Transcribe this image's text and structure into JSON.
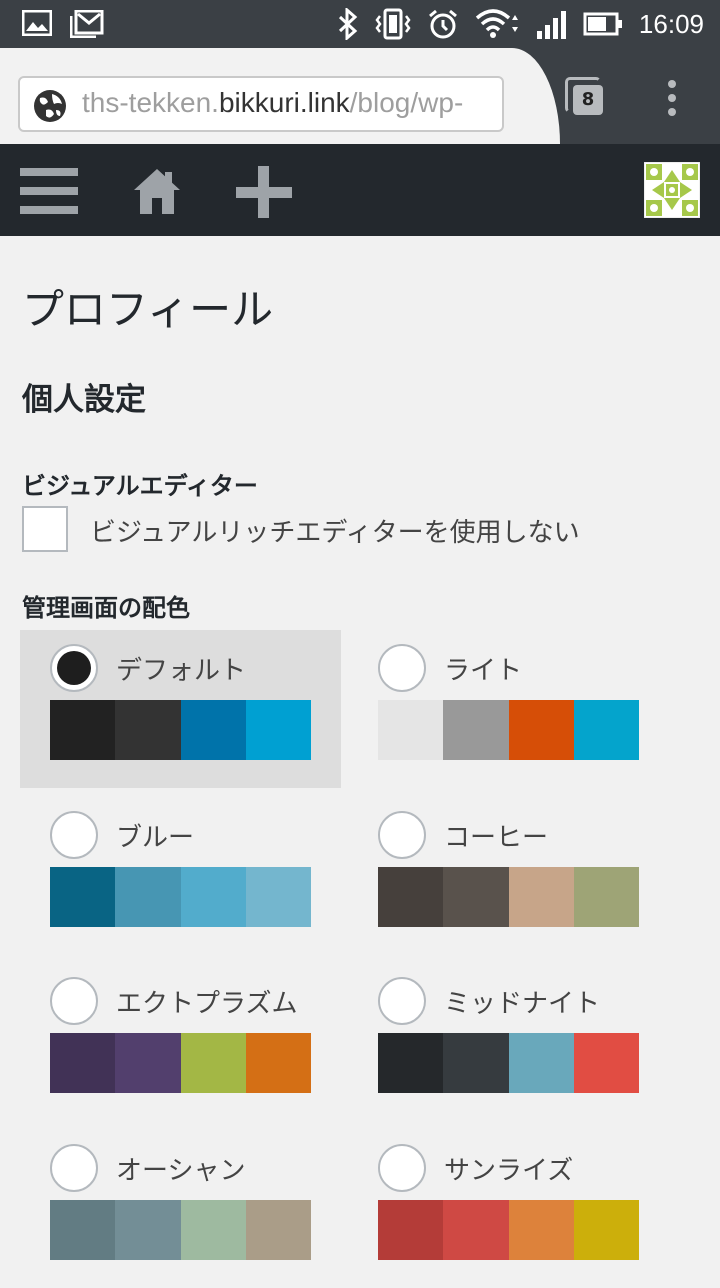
{
  "statusbar": {
    "time": "16:09",
    "icons": [
      "image-icon",
      "gmail-icon",
      "bluetooth-icon",
      "vibrate-icon",
      "alarm-icon",
      "wifi-icon",
      "signal-icon",
      "battery-icon"
    ]
  },
  "browser": {
    "url_prefix": "ths-tekken.",
    "url_host": "bikkuri.link",
    "url_suffix": "/blog/wp-",
    "tab_count": "8"
  },
  "adminbar": {
    "icons": [
      "hamburger-menu-icon",
      "home-icon",
      "plus-icon"
    ],
    "avatar_color": "#a6c84a"
  },
  "page": {
    "title": "プロフィール",
    "section_title": "個人設定",
    "visual_editor_label": "ビジュアルエディター",
    "visual_editor_checkbox_label": "ビジュアルリッチエディターを使用しない",
    "visual_editor_checked": false,
    "color_scheme_label": "管理画面の配色"
  },
  "color_schemes": [
    {
      "name": "デフォルト",
      "selected": true,
      "colors": [
        "#222222",
        "#333333",
        "#0073aa",
        "#00a0d2"
      ]
    },
    {
      "name": "ライト",
      "selected": false,
      "colors": [
        "#e5e5e5",
        "#999999",
        "#d64e07",
        "#04a4cc"
      ]
    },
    {
      "name": "ブルー",
      "selected": false,
      "colors": [
        "#096484",
        "#4796b3",
        "#52accc",
        "#74b6ce"
      ]
    },
    {
      "name": "コーヒー",
      "selected": false,
      "colors": [
        "#46403c",
        "#59524c",
        "#c7a589",
        "#9ea476"
      ]
    },
    {
      "name": "エクトプラズム",
      "selected": false,
      "colors": [
        "#413256",
        "#523f6d",
        "#a3b745",
        "#d46f15"
      ]
    },
    {
      "name": "ミッドナイト",
      "selected": false,
      "colors": [
        "#25282b",
        "#363b3f",
        "#69a8bb",
        "#e14d43"
      ]
    },
    {
      "name": "オーシャン",
      "selected": false,
      "colors": [
        "#627c83",
        "#738e96",
        "#9ebaa0",
        "#aa9d88"
      ]
    },
    {
      "name": "サンライズ",
      "selected": false,
      "colors": [
        "#b43c38",
        "#cf4944",
        "#dd823b",
        "#ccaf0b"
      ]
    }
  ]
}
